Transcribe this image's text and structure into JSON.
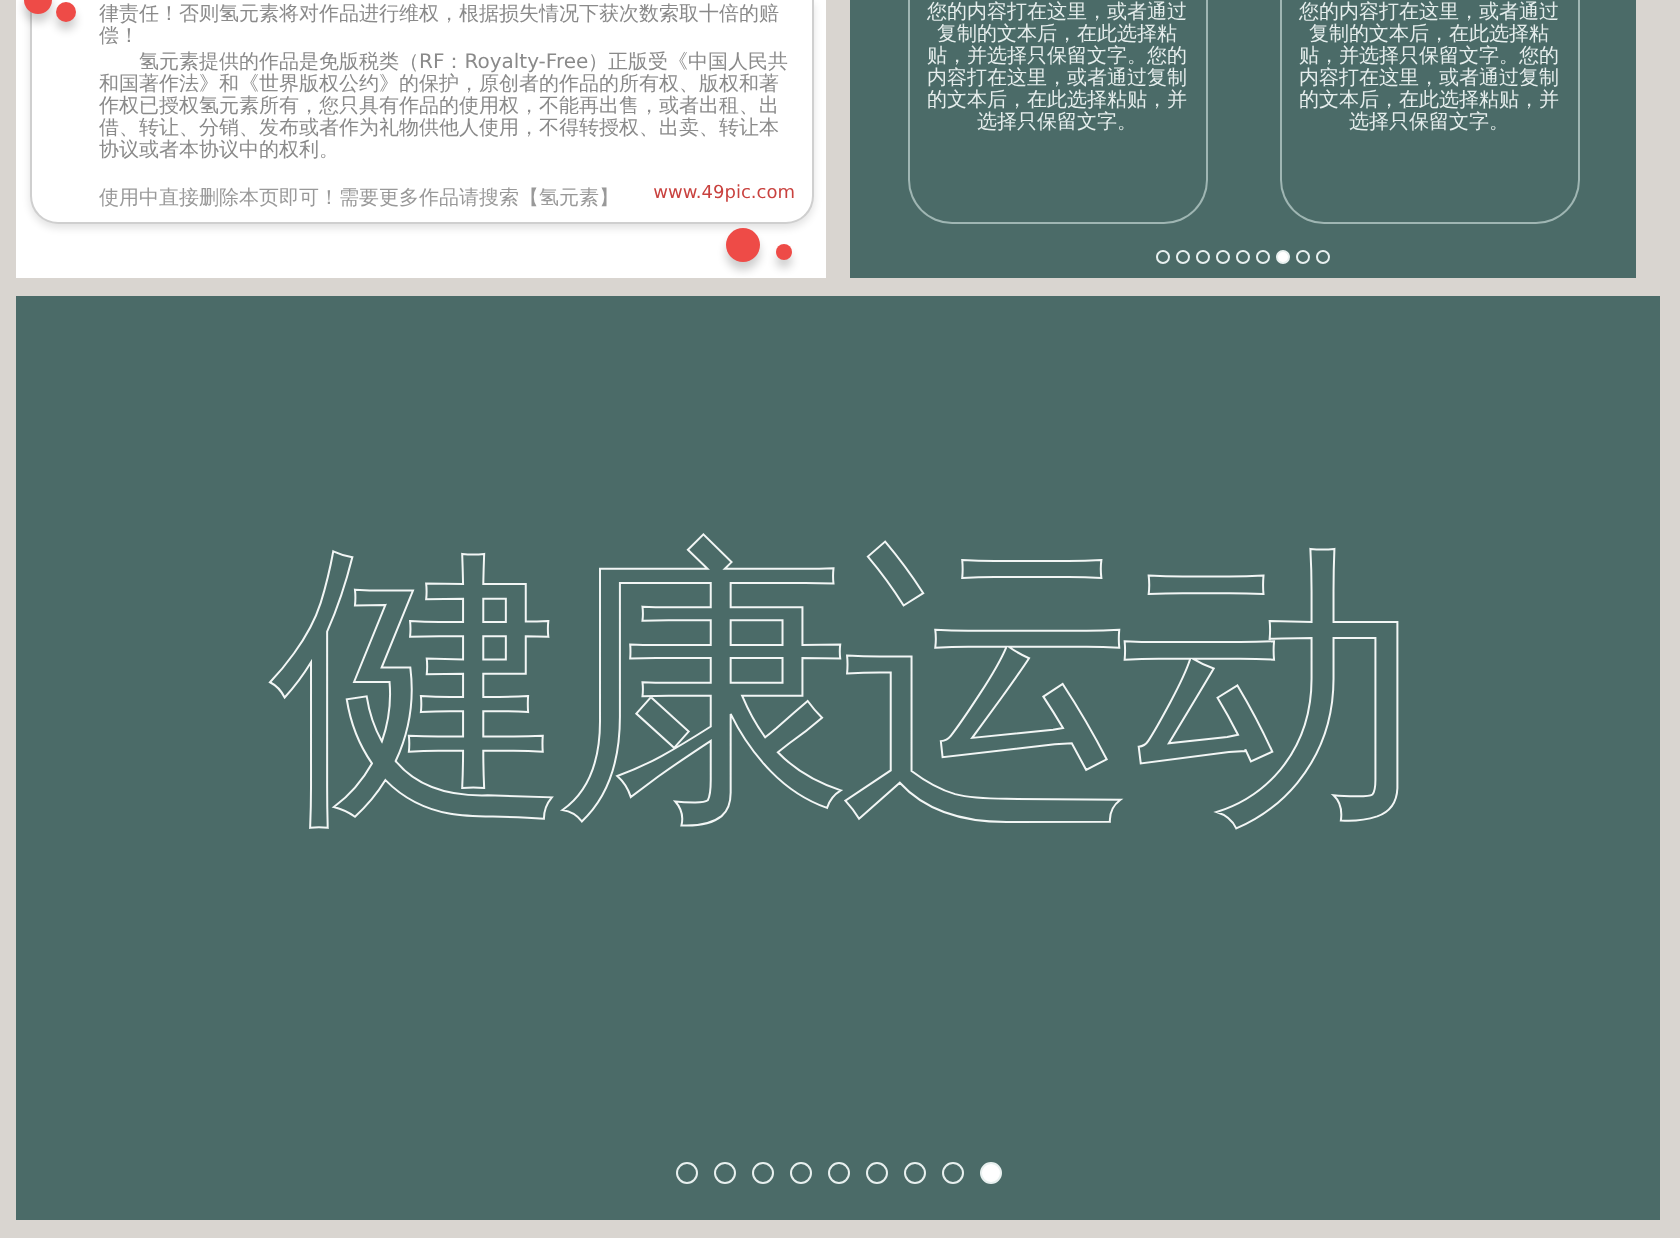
{
  "slides": [
    {
      "kind": "notice",
      "paragraphs": [
        "律责任！否则氢元素将对作品进行维权，根据损失情况下获次数索取十倍的赔偿！",
        "氢元素提供的作品是免版税类（RF：Royalty-Free）正版受《中国人民共和国著作法》和《世界版权公约》的保护，原创者的作品的所有权、版权和著作权已授权氢元素所有，您只具有作品的使用权，不能再出售，或者出租、出借、转让、分销、发布或者作为礼物供他人使用，不得转授权、出卖、转让本协议或者本协议中的权利。"
      ],
      "footer_note": "使用中直接删除本页即可！需要更多作品请搜索【氢元素】",
      "footer_link": "www.49pic.com"
    },
    {
      "kind": "cards",
      "cards": [
        "您的内容打在这里，或者通过复制的文本后，在此选择粘贴，并选择只保留文字。您的内容打在这里，或者通过复制的文本后，在此选择粘贴，并选择只保留文字。",
        "您的内容打在这里，或者通过复制的文本后，在此选择粘贴，并选择只保留文字。您的内容打在这里，或者通过复制的文本后，在此选择粘贴，并选择只保留文字。"
      ],
      "dots": [
        {
          "selected": false
        },
        {
          "selected": false
        },
        {
          "selected": false
        },
        {
          "selected": false
        },
        {
          "selected": false
        },
        {
          "selected": false
        },
        {
          "selected": true
        },
        {
          "selected": false
        },
        {
          "selected": false
        }
      ]
    },
    {
      "kind": "title",
      "title": "健康运动",
      "dots": [
        {
          "selected": false
        },
        {
          "selected": false
        },
        {
          "selected": false
        },
        {
          "selected": false
        },
        {
          "selected": false
        },
        {
          "selected": false
        },
        {
          "selected": false
        },
        {
          "selected": false
        },
        {
          "selected": true
        }
      ]
    }
  ]
}
